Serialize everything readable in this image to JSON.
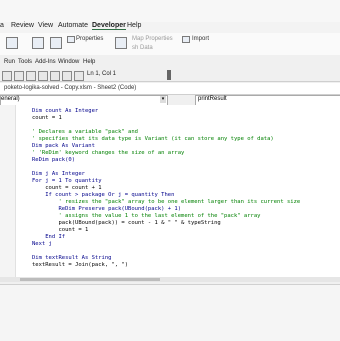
{
  "excel_menu": [
    "a",
    "Review",
    "View",
    "Automate",
    "Developer",
    "Help"
  ],
  "ribbon": {
    "properties": "Properties",
    "map_properties": "Map Properties",
    "import": "Import",
    "refresh": "sh Data"
  },
  "vbe_menu": [
    "Run",
    "Tools",
    "Add-Ins",
    "Window",
    "Help"
  ],
  "cursor_position": "Ln 1, Col 1",
  "document_title": "poketo-logika-solved - Copy.xlsm - Sheet2 (Code)",
  "object_combo": "eneral)",
  "procedure_combo": "printResult",
  "code_lines": [
    {
      "text": "Dim count As Integer",
      "type": "kw"
    },
    {
      "text": "count = 1",
      "type": "code"
    },
    {
      "text": "",
      "type": "code"
    },
    {
      "text": "' Declares a variable \"pack\" and",
      "type": "cm"
    },
    {
      "text": "' specifies that its data type is Variant (it can store any type of data)",
      "type": "cm"
    },
    {
      "text": "Dim pack As Variant",
      "type": "kw"
    },
    {
      "text": "' 'ReDim' keyword changes the size of an array",
      "type": "cm"
    },
    {
      "text": "ReDim pack(0)",
      "type": "kw"
    },
    {
      "text": "",
      "type": "code"
    },
    {
      "text": "Dim j As Integer",
      "type": "kw"
    },
    {
      "text": "For j = 1 To quantity",
      "type": "kw"
    },
    {
      "text": "    count = count + 1",
      "type": "code"
    },
    {
      "text": "    If count > package Or j = quantity Then",
      "type": "kw"
    },
    {
      "text": "        ' resizes the \"pack\" array to be one element larger than its current size",
      "type": "cm"
    },
    {
      "text": "        ReDim Preserve pack(UBound(pack) + 1)",
      "type": "kw"
    },
    {
      "text": "        ' assigns the value 1 to the last element of the \"pack\" array",
      "type": "cm"
    },
    {
      "text": "        pack(UBound(pack)) = count - 1 & \" \" & typeString",
      "type": "code"
    },
    {
      "text": "        count = 1",
      "type": "code"
    },
    {
      "text": "    End If",
      "type": "kw"
    },
    {
      "text": "Next j",
      "type": "kw"
    },
    {
      "text": "",
      "type": "code"
    },
    {
      "text": "Dim textResult As String",
      "type": "kw"
    },
    {
      "text": "textResult = Join(pack, \", \")",
      "type": "code"
    }
  ],
  "colors": {
    "keyword": "#00008b",
    "comment": "#008000",
    "code": "#000000",
    "developer_underline": "#2f6f44"
  }
}
